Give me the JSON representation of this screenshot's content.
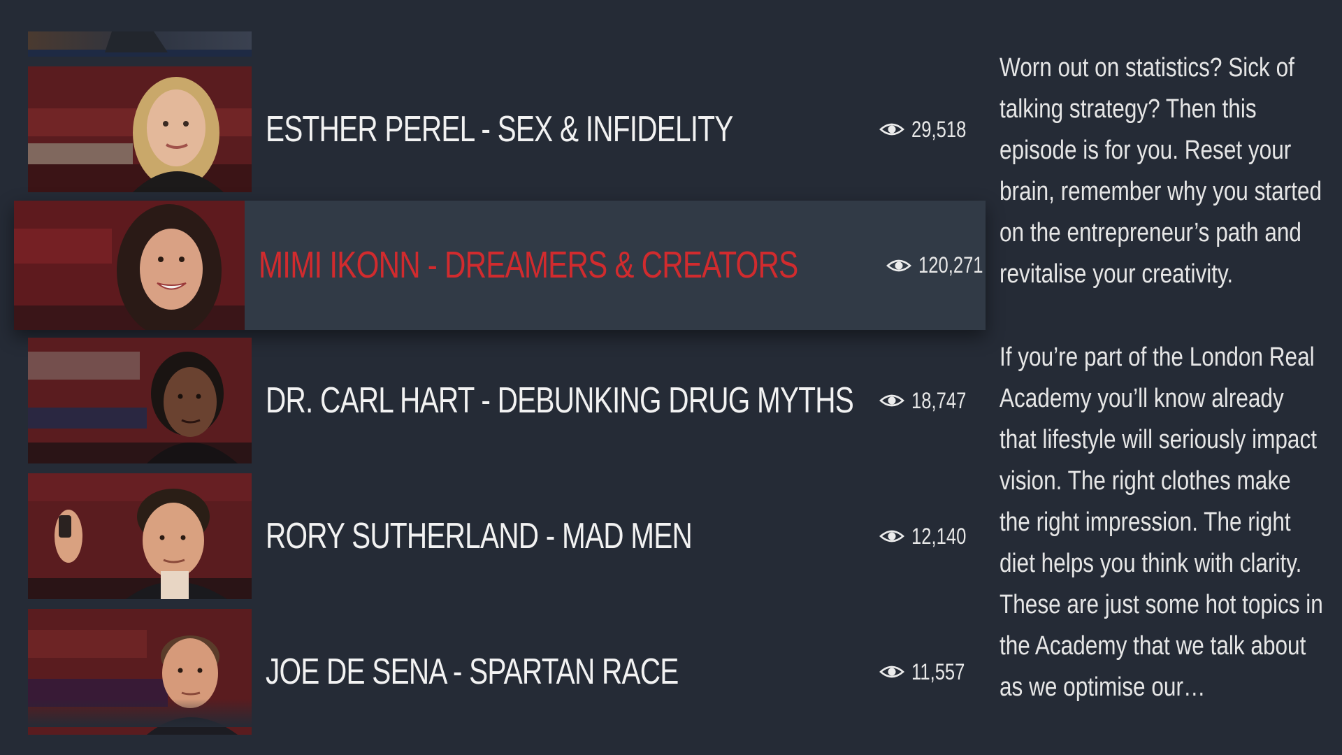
{
  "episodes": [
    {
      "title": "ESTHER PEREL - SEX & INFIDELITY",
      "views": "29,518",
      "thumb_icon": "portrait-woman-blonde",
      "active": false
    },
    {
      "title": "MIMI IKONN - DREAMERS & CREATORS",
      "views": "120,271",
      "thumb_icon": "portrait-woman-dark-hair",
      "active": true
    },
    {
      "title": "DR. CARL HART - DEBUNKING DRUG MYTHS",
      "views": "18,747",
      "thumb_icon": "portrait-man-dreadlocks",
      "active": false
    },
    {
      "title": "RORY SUTHERLAND - MAD MEN",
      "views": "12,140",
      "thumb_icon": "portrait-man-curly-hair",
      "active": false
    },
    {
      "title": "JOE DE SENA - SPARTAN RACE",
      "views": "11,557",
      "thumb_icon": "portrait-man-short-hair",
      "active": false
    }
  ],
  "description": {
    "paragraph_1": "Worn out on statistics? Sick of talking strategy? Then this episode is for you. Reset your brain, remember why you started on the entrepreneur’s path and revitalise your creativity.",
    "paragraph_2": "If you’re part of the London Real Academy you’ll know already that lifestyle will seriously impact vision. The right clothes make the right impression. The right diet helps you think with clarity. These are just some hot topics in the Academy that we talk about as we optimise our…"
  },
  "colors": {
    "background": "#252b36",
    "active_row": "#313a46",
    "active_title": "#d12b2e",
    "text": "#f2f2f2"
  },
  "icons": {
    "views": "eye-icon"
  }
}
